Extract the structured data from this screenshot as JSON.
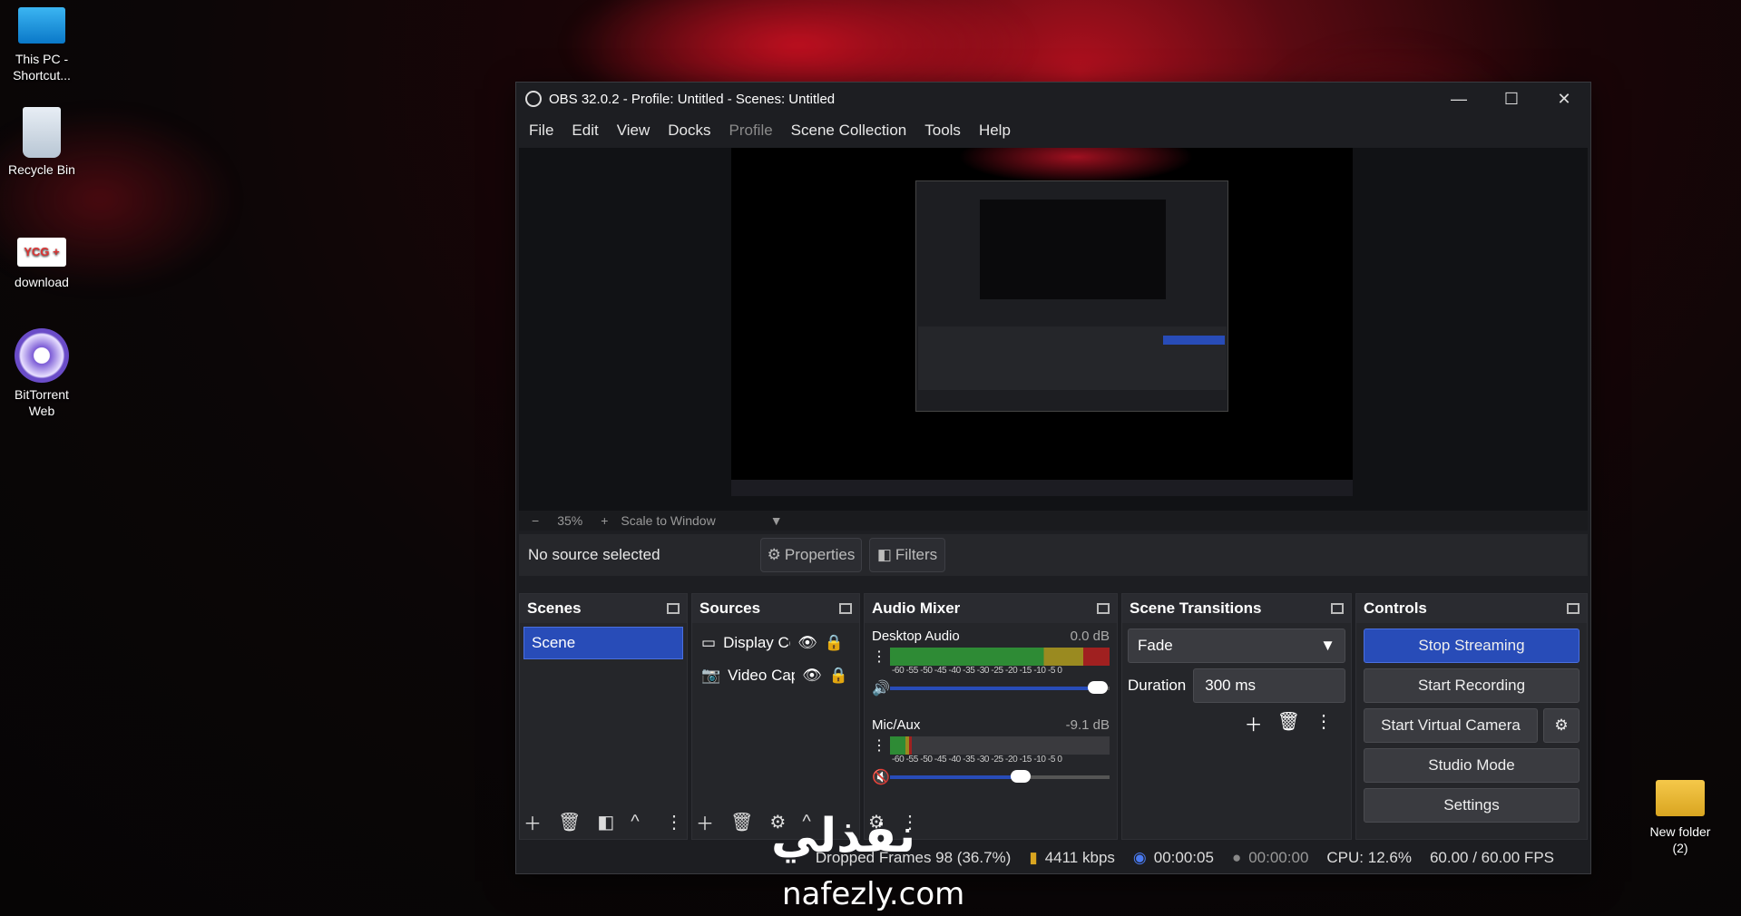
{
  "desktop": {
    "icons": [
      {
        "label": "This PC - Shortcut..."
      },
      {
        "label": "Recycle Bin"
      },
      {
        "label": "download"
      },
      {
        "label": "BitTorrent Web"
      },
      {
        "label": "New folder (2)"
      }
    ]
  },
  "window": {
    "title": "OBS 32.0.2 - Profile: Untitled - Scenes: Untitled",
    "controls": {
      "minimize": "—",
      "maximize": "☐",
      "close": "✕"
    }
  },
  "menu": [
    "File",
    "Edit",
    "View",
    "Docks",
    "Profile",
    "Scene Collection",
    "Tools",
    "Help"
  ],
  "zoom": {
    "minus": "−",
    "value": "35%",
    "plus": "+",
    "mode": "Scale to Window"
  },
  "source_bar": {
    "status": "No source selected",
    "properties": "Properties",
    "filters": "Filters"
  },
  "scenes": {
    "title": "Scenes",
    "items": [
      "Scene"
    ]
  },
  "sources": {
    "title": "Sources",
    "items": [
      {
        "name": "Display Cc"
      },
      {
        "name": "Video Cap"
      }
    ]
  },
  "audio_mixer": {
    "title": "Audio Mixer",
    "channels": [
      {
        "name": "Desktop Audio",
        "db": "0.0 dB",
        "level": 1.0,
        "volume": 0.95
      },
      {
        "name": "Mic/Aux",
        "db": "-9.1 dB",
        "level": 0.1,
        "volume": 0.6
      }
    ],
    "scale": [
      "-60",
      "-55",
      "-50",
      "-45",
      "-40",
      "-35",
      "-30",
      "-25",
      "-20",
      "-15",
      "-10",
      "-5",
      "0"
    ]
  },
  "transitions": {
    "title": "Scene Transitions",
    "selected": "Fade",
    "duration_label": "Duration",
    "duration": "300 ms"
  },
  "controls": {
    "title": "Controls",
    "stop_streaming": "Stop Streaming",
    "start_recording": "Start Recording",
    "start_virtual_camera": "Start Virtual Camera",
    "studio_mode": "Studio Mode",
    "settings": "Settings"
  },
  "status": {
    "dropped": "Dropped Frames 98 (36.7%)",
    "bitrate": "4411 kbps",
    "stream_time": "00:00:05",
    "rec_time": "00:00:00",
    "cpu": "CPU: 12.6%",
    "fps": "60.00 / 60.00 FPS"
  },
  "watermark": {
    "arabic": "نفذلي",
    "site": "nafezly.com"
  },
  "colors": {
    "accent": "#284cb8",
    "meter_green": "#2e8b35",
    "meter_yellow": "#9a8a20",
    "meter_red": "#a02020"
  }
}
